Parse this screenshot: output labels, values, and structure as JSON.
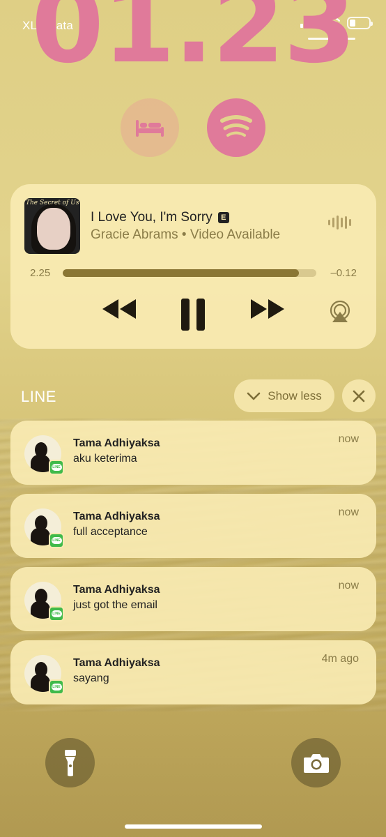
{
  "status_bar": {
    "carrier": "XL Axiata"
  },
  "lock_screen": {
    "time": "01.23",
    "widgets": [
      "bed-icon",
      "spotify-icon"
    ]
  },
  "now_playing": {
    "title": "I Love You, I'm Sorry",
    "explicit_badge": "E",
    "artist_line": "Gracie Abrams • Video Available",
    "album_title": "The Secret of Us",
    "elapsed": "2.25",
    "remaining": "–0.12",
    "progress_fraction": 0.93
  },
  "notification_group": {
    "app": "LINE",
    "show_less_label": "Show less",
    "items": [
      {
        "sender": "Tama Adhiyaksa",
        "message": "aku keterima",
        "time": "now"
      },
      {
        "sender": "Tama Adhiyaksa",
        "message": "full acceptance",
        "time": "now"
      },
      {
        "sender": "Tama Adhiyaksa",
        "message": "just got the email",
        "time": "now"
      },
      {
        "sender": "Tama Adhiyaksa",
        "message": "sayang",
        "time": "4m ago"
      }
    ],
    "badge_text": "LINE"
  },
  "colors": {
    "accent_pink": "#e07a9a",
    "card_bg": "#f8eab2",
    "line_green": "#3fba4a"
  }
}
